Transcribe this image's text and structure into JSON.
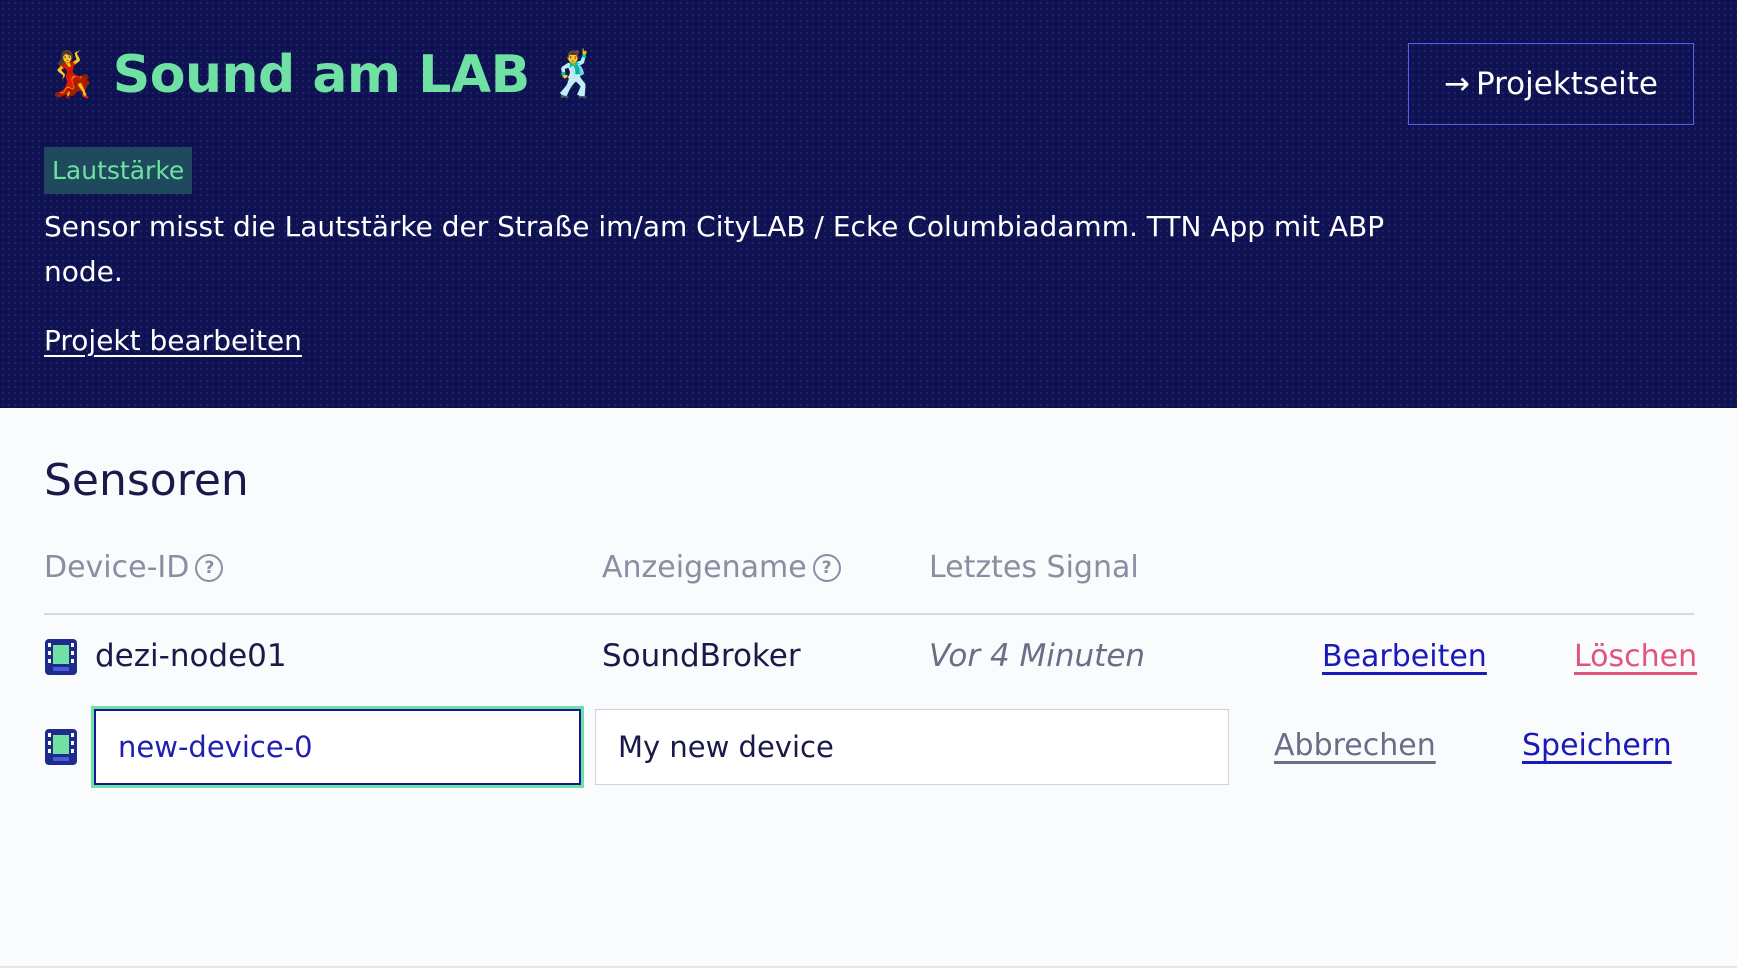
{
  "header": {
    "emoji_left": "💃",
    "title": "Sound am LAB",
    "emoji_right": "🕺",
    "project_button_arrow": "→",
    "project_button_label": "Projektseite",
    "tag": "Lautstärke",
    "description": "Sensor misst die Lautstärke der Straße im/am CityLAB / Ecke Columbiadamm. TTN App mit ABP node.",
    "edit_link": "Projekt bearbeiten"
  },
  "sensors": {
    "heading": "Sensoren",
    "columns": {
      "device_id": "Device-ID",
      "display_name": "Anzeigename",
      "last_signal": "Letztes Signal",
      "help_glyph": "?"
    },
    "rows": [
      {
        "device_id": "dezi-node01",
        "display_name": "SoundBroker",
        "last_signal": "Vor 4 Minuten",
        "edit_label": "Bearbeiten",
        "delete_label": "Löschen"
      }
    ],
    "new_row": {
      "device_id_value": "new-device-0",
      "display_name_value": "My new device",
      "cancel_label": "Abbrechen",
      "save_label": "Speichern"
    }
  },
  "colors": {
    "hero_bg": "#0f1252",
    "accent_green": "#6fe1a3",
    "link_blue": "#1a1ab8",
    "delete_pink": "#e0567a",
    "muted": "#8a8ea2"
  },
  "icons": {
    "device": "device-icon",
    "help": "question-circle-icon",
    "arrow": "arrow-right-icon"
  }
}
